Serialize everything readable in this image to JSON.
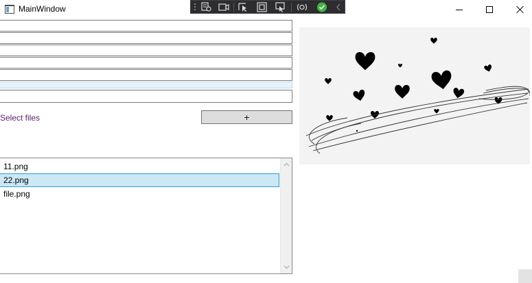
{
  "window": {
    "title": "MainWindow",
    "icons": {
      "app": "window-app-icon",
      "minimize": "minimize-icon",
      "maximize": "maximize-icon",
      "close": "close-icon"
    }
  },
  "debug_toolbar": {
    "icons": [
      "grip-icon",
      "select-element-icon",
      "video-camera-icon",
      "pointer-select-icon",
      "display-adorner-icon",
      "track-focus-icon",
      "hot-reload-icon",
      "checkmark-status-icon",
      "collapse-chevron-icon"
    ],
    "status_color": "#3fb63f"
  },
  "form": {
    "fields": [
      {
        "value": ""
      },
      {
        "value": ""
      },
      {
        "value": ""
      },
      {
        "value": ""
      },
      {
        "value": ""
      },
      {
        "value": ""
      },
      {
        "value": ""
      }
    ],
    "select_files_label": "Select files",
    "add_button_label": "+"
  },
  "file_list": {
    "items": [
      "11.png",
      "22.png",
      "file.png"
    ],
    "selected_index": 1
  },
  "preview": {
    "icon": "hearts-image"
  },
  "colors": {
    "link": "#5b1f6e",
    "selection_bg": "#cce8f4",
    "selection_border": "#26a0da"
  }
}
